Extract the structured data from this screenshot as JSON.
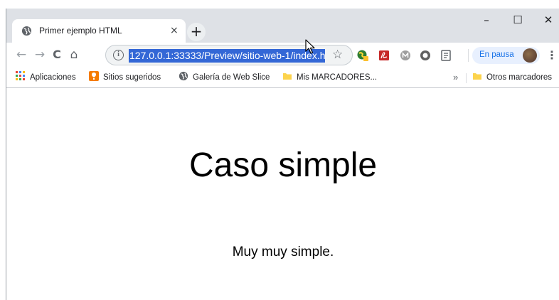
{
  "tab": {
    "title": "Primer ejemplo HTML",
    "favicon": "globe-icon",
    "close_label": "×"
  },
  "tabstrip": {
    "new_tab_label": "+"
  },
  "window_controls": {
    "minimize": "–",
    "maximize": "☐",
    "close": "✕"
  },
  "toolbar": {
    "back": "←",
    "forward": "→",
    "reload": "C",
    "home": "⌂",
    "info_label": "i",
    "url": "127.0.0.1:33333/Preview/sitio-web-1/index.h",
    "star": "☆",
    "paused_label": "En pausa",
    "menu": "⋮",
    "extensions": [
      "globe-extension-icon",
      "pdf-icon",
      "m-extension-icon",
      "circle-extension-icon",
      "reader-icon"
    ]
  },
  "bookmarks": {
    "items": [
      {
        "label": "Aplicaciones",
        "icon": "apps-grid-icon"
      },
      {
        "label": "Sitios sugeridos",
        "icon": "suggested-sites-icon"
      },
      {
        "label": "Galería de Web Slice",
        "icon": "globe-icon"
      },
      {
        "label": "Mis MARCADORES...",
        "icon": "folder-icon"
      }
    ],
    "more": "»",
    "other_label": "Otros marcadores"
  },
  "page": {
    "heading": "Caso simple",
    "paragraph": "Muy muy simple."
  },
  "colors": {
    "tabstrip": "#dee1e6",
    "url_highlight": "#3367d6",
    "paused_bg": "#e8f0fe",
    "paused_text": "#1a73e8"
  }
}
